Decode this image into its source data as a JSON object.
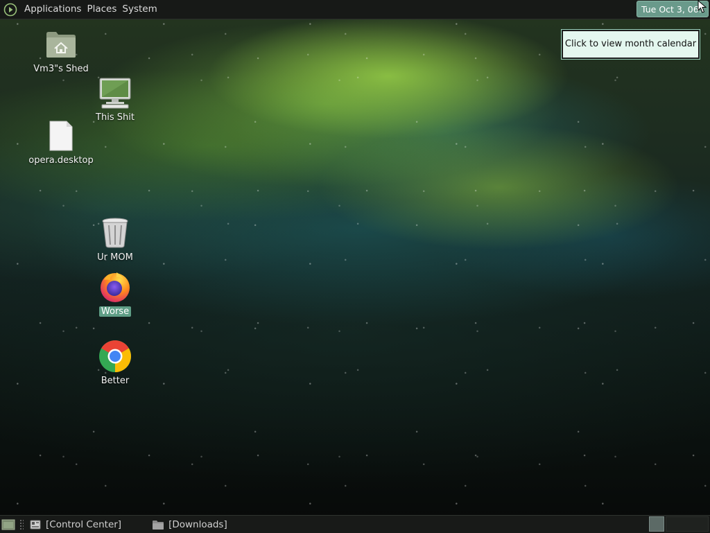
{
  "top_panel": {
    "menus": [
      "Applications",
      "Places",
      "System"
    ],
    "clock_text": "Tue Oct  3, 06:",
    "tooltip": "Click to view month calendar"
  },
  "desktop": {
    "icons": [
      {
        "label": "Vm3\"s Shed",
        "icon": "home-folder-icon"
      },
      {
        "label": "This Shit",
        "icon": "computer-icon"
      },
      {
        "label": "opera.desktop",
        "icon": "document-icon"
      },
      {
        "label": "Ur MOM",
        "icon": "trash-icon"
      },
      {
        "label": "Worse",
        "icon": "firefox-icon",
        "selected": true
      },
      {
        "label": "Better",
        "icon": "chrome-icon"
      }
    ]
  },
  "bottom_panel": {
    "tasks": [
      {
        "label": "[Control Center]",
        "icon": "control-center-icon"
      },
      {
        "label": "[Downloads]",
        "icon": "folder-icon"
      }
    ]
  },
  "colors": {
    "accent": "#5f9e86",
    "tooltip_bg": "#e4f7ef",
    "panel_bg": "#171917"
  }
}
